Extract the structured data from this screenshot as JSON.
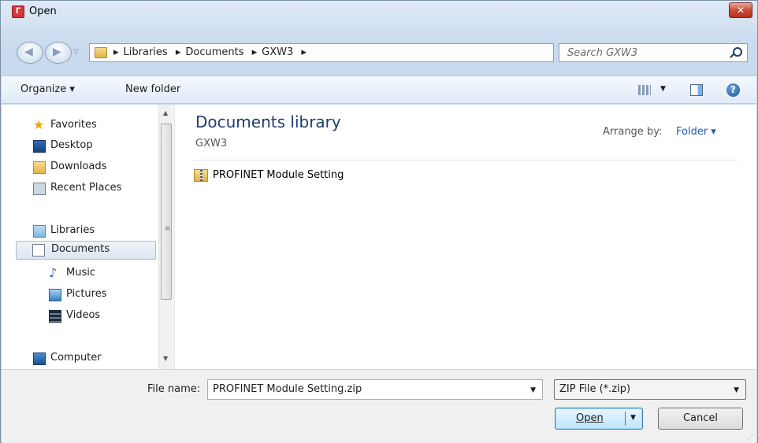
{
  "window": {
    "title": "Open",
    "close_label": "✕"
  },
  "address": {
    "crumbs": [
      "Libraries",
      "Documents",
      "GXW3"
    ]
  },
  "search": {
    "placeholder": "Search GXW3"
  },
  "toolbar": {
    "organize": "Organize ▾",
    "new_folder": "New folder",
    "help_label": "?"
  },
  "nav": {
    "favorites": "Favorites",
    "desktop": "Desktop",
    "downloads": "Downloads",
    "recent_places": "Recent Places",
    "libraries": "Libraries",
    "documents": "Documents",
    "music": "Music",
    "pictures": "Pictures",
    "videos": "Videos",
    "computer": "Computer"
  },
  "content": {
    "title": "Documents library",
    "subtitle": "GXW3",
    "arrange_label": "Arrange by:",
    "arrange_value": "Folder ▾",
    "files": [
      "PROFINET Module Setting"
    ]
  },
  "bottom": {
    "file_name_label": "File name:",
    "file_name_value": "PROFINET Module Setting.zip",
    "filter_value": "ZIP File (*.zip)",
    "open_label": "Open",
    "cancel_label": "Cancel"
  },
  "colors": {
    "title_accent": "#1e3d70",
    "link": "#1e5aa8",
    "selection": "#dce6f2"
  },
  "icons": [
    "app-icon",
    "back-icon",
    "forward-icon",
    "folder-icon",
    "refresh-icon",
    "search-icon",
    "views-icon",
    "preview-pane-icon",
    "help-icon",
    "star-icon",
    "desktop-icon",
    "downloads-icon",
    "recent-places-icon",
    "libraries-icon",
    "documents-icon",
    "music-icon",
    "pictures-icon",
    "videos-icon",
    "computer-icon",
    "zip-folder-icon"
  ]
}
